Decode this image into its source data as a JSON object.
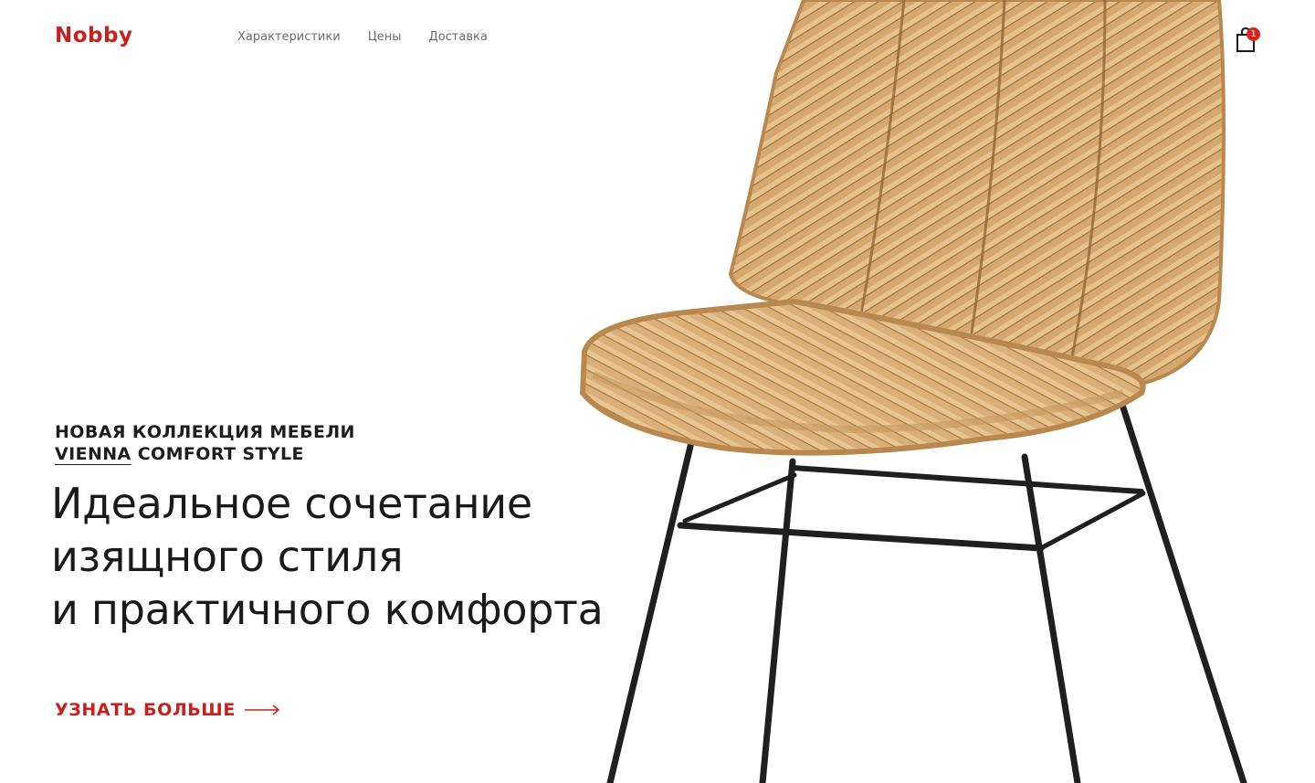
{
  "header": {
    "logo": "Nobby",
    "nav": [
      "Характеристики",
      "Цены",
      "Доставка"
    ],
    "cart_count": "1"
  },
  "hero": {
    "kicker_line1": "НОВАЯ КОЛЛЕКЦИЯ МЕБЕЛИ",
    "kicker_brand": "VIENNA",
    "kicker_rest": "COMFORT STYLE",
    "headline": [
      "Идеальное сочетание",
      "изящного стиля",
      "и практичного комфорта"
    ],
    "cta_label": "УЗНАТЬ БОЛЬШЕ"
  },
  "icons": {
    "cart": "shopping-bag-icon",
    "cta_arrow": "long-arrow-right-icon"
  },
  "colors": {
    "accent": "#c8201e",
    "badge": "#d8231f",
    "text": "#1a1a1a",
    "nav_text": "#6b6b6b",
    "rattan": "#d9b07a",
    "frame": "#1f1f1f"
  }
}
